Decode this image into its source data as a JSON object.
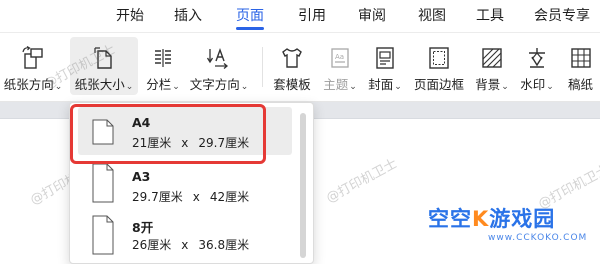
{
  "menubar": {
    "tabs": [
      {
        "label": "开始",
        "active": false
      },
      {
        "label": "插入",
        "active": false
      },
      {
        "label": "页面",
        "active": true
      },
      {
        "label": "引用",
        "active": false
      },
      {
        "label": "审阅",
        "active": false
      },
      {
        "label": "视图",
        "active": false
      },
      {
        "label": "工具",
        "active": false
      },
      {
        "label": "会员专享",
        "active": false
      }
    ]
  },
  "ribbon": {
    "paper_orientation": {
      "label": "纸张方向",
      "icon": "paper-orientation-icon"
    },
    "paper_size": {
      "label": "纸张大小",
      "icon": "paper-size-icon"
    },
    "columns": {
      "label": "分栏",
      "icon": "columns-icon"
    },
    "text_direction": {
      "label": "文字方向",
      "icon": "text-direction-icon"
    },
    "template": {
      "label": "套模板",
      "icon": "template-shirt-icon"
    },
    "theme": {
      "label": "主题",
      "icon": "theme-icon"
    },
    "cover": {
      "label": "封面",
      "icon": "cover-icon"
    },
    "page_border": {
      "label": "页面边框",
      "icon": "page-border-icon"
    },
    "background": {
      "label": "背景",
      "icon": "background-icon"
    },
    "watermark": {
      "label": "水印",
      "icon": "watermark-icon"
    },
    "manuscript": {
      "label": "稿纸",
      "icon": "manuscript-icon"
    }
  },
  "dropdown": {
    "items": [
      {
        "name": "A4",
        "width": "21厘米",
        "height": "29.7厘米",
        "selected": true
      },
      {
        "name": "A3",
        "width": "29.7厘米",
        "height": "42厘米",
        "selected": false
      },
      {
        "name": "8开",
        "width": "26厘米",
        "height": "36.8厘米",
        "selected": false
      }
    ],
    "times": "x"
  },
  "watermark_text": "@打印机卫士",
  "logo": {
    "main": "空空",
    "accent": "K",
    "tail": "游戏园",
    "sub": "www.CCKOKO.COM"
  },
  "colors": {
    "accent": "#2a63e6",
    "highlight_border": "#e53935"
  }
}
